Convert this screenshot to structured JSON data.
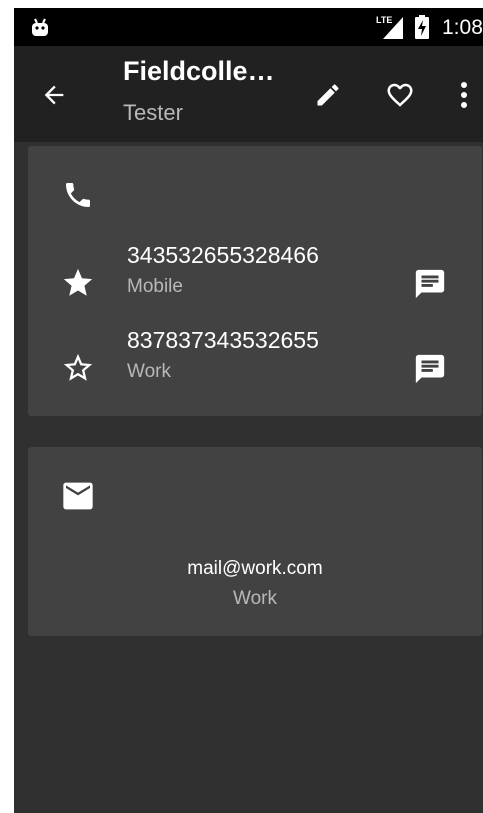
{
  "status_bar": {
    "network_label": "LTE",
    "time": "1:08",
    "icons": [
      "android-icon",
      "lte-signal-icon",
      "battery-charging-icon"
    ]
  },
  "app_bar": {
    "title": "Fieldcolle…",
    "subtitle": "Tester",
    "icons": [
      "back-arrow-icon",
      "edit-pencil-icon",
      "heart-outline-icon",
      "more-vert-icon"
    ]
  },
  "phone_section": {
    "section_icon": "phone-icon",
    "entries": [
      {
        "number": "343532655328466",
        "type": "Mobile",
        "starred": true,
        "action_icon": "message-icon"
      },
      {
        "number": "837837343532655",
        "type": "Work",
        "starred": false,
        "action_icon": "message-icon"
      }
    ]
  },
  "email_section": {
    "section_icon": "email-icon",
    "address": "mail@work.com",
    "type": "Work"
  },
  "colors": {
    "background": "#303030",
    "app_bar": "#212121",
    "card": "#424242",
    "status_bar": "#000000",
    "primary_text": "#ffffff",
    "secondary_text": "#b8b8b8"
  }
}
